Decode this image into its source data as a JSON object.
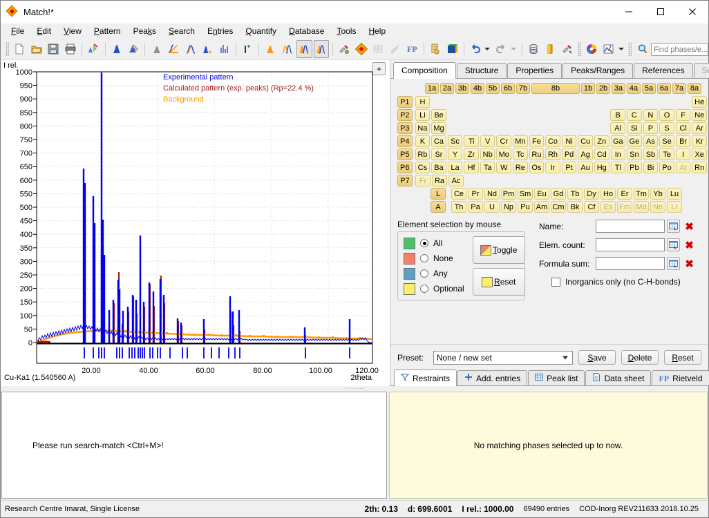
{
  "window": {
    "title": "Match!*",
    "app_icon": "diamond-icon",
    "minimize": "—",
    "maximize": "□",
    "close": "✕"
  },
  "menu": [
    {
      "label": "File",
      "accel": "F"
    },
    {
      "label": "Edit",
      "accel": "E"
    },
    {
      "label": "View",
      "accel": "V"
    },
    {
      "label": "Pattern",
      "accel": "P"
    },
    {
      "label": "Peaks",
      "accel": "k"
    },
    {
      "label": "Search",
      "accel": "S"
    },
    {
      "label": "Entries",
      "accel": "n"
    },
    {
      "label": "Quantify",
      "accel": "Q"
    },
    {
      "label": "Database",
      "accel": "D"
    },
    {
      "label": "Tools",
      "accel": "T"
    },
    {
      "label": "Help",
      "accel": "H"
    }
  ],
  "toolbar": {
    "icons": [
      "new-document-icon",
      "open-folder-icon",
      "save-disk-icon",
      "print-icon",
      "import-pattern-icon",
      "peak-single-icon",
      "pattern-tools-icon",
      "raw-profile-icon",
      "background-icon",
      "smooth-icon",
      "strip-ka2-icon",
      "peak-bars-icon",
      "add-peak-icon",
      "single-peak-fit-icon",
      "profile-fit-icon",
      "fit-profile-a-icon",
      "fit-profile-b-icon",
      "search-match-tools-icon",
      "diamond-entry-icon",
      "disabled-grid-icon",
      "disabled-pencil-icon",
      "fp-label",
      "report-icon",
      "3d-cube-icon",
      "undo-icon",
      "redo-icon",
      "database-icon",
      "gold-bar-icon",
      "settings-tools-icon",
      "color-wheel-icon",
      "chart-options-icon",
      "search-icon"
    ],
    "fp_label": "FP",
    "search_placeholder": "Find phases/e..."
  },
  "chart_data": {
    "type": "line",
    "title": "",
    "xlabel": "2theta",
    "ylabel": "I rel.",
    "source_label": "Cu-Ka1 (1.540560 A)",
    "xlim": [
      3,
      120
    ],
    "ylim": [
      0,
      1000
    ],
    "xticks": [
      "20.00",
      "40.00",
      "60.00",
      "80.00",
      "100.00",
      "120.00"
    ],
    "xtick_values": [
      20,
      40,
      60,
      80,
      100,
      120
    ],
    "yticks": [
      "0",
      "50",
      "100",
      "150",
      "200",
      "250",
      "300",
      "350",
      "400",
      "450",
      "500",
      "550",
      "600",
      "650",
      "700",
      "750",
      "800",
      "850",
      "900",
      "950",
      "1000"
    ],
    "ytick_values": [
      0,
      50,
      100,
      150,
      200,
      250,
      300,
      350,
      400,
      450,
      500,
      550,
      600,
      650,
      700,
      750,
      800,
      850,
      900,
      950,
      1000
    ],
    "grid": true,
    "legend": [
      {
        "label": "Experimental pattern",
        "color": "#0000ee"
      },
      {
        "label": "Calculated pattern (exp. peaks) (Rp=22.4 %)",
        "color": "#a02020"
      },
      {
        "label": "Background",
        "color": "#ff9900"
      }
    ],
    "series": [
      {
        "name": "Experimental pattern",
        "color": "#0000ee",
        "peaks": [
          {
            "x": 17.8,
            "y": 645
          },
          {
            "x": 17.5,
            "y": 592
          },
          {
            "x": 20.9,
            "y": 540
          },
          {
            "x": 21.2,
            "y": 445
          },
          {
            "x": 23.6,
            "y": 1000
          },
          {
            "x": 24.1,
            "y": 455
          },
          {
            "x": 24.4,
            "y": 325
          },
          {
            "x": 26.5,
            "y": 120
          },
          {
            "x": 28.0,
            "y": 160
          },
          {
            "x": 29.5,
            "y": 235
          },
          {
            "x": 30.1,
            "y": 200
          },
          {
            "x": 31.4,
            "y": 118
          },
          {
            "x": 33.2,
            "y": 135
          },
          {
            "x": 34.4,
            "y": 175
          },
          {
            "x": 35.5,
            "y": 160
          },
          {
            "x": 36.1,
            "y": 402
          },
          {
            "x": 36.8,
            "y": 150
          },
          {
            "x": 38.6,
            "y": 225
          },
          {
            "x": 39.2,
            "y": 190
          },
          {
            "x": 41.5,
            "y": 235
          },
          {
            "x": 42.0,
            "y": 180
          },
          {
            "x": 47.2,
            "y": 90
          },
          {
            "x": 47.6,
            "y": 75
          },
          {
            "x": 55.5,
            "y": 88
          },
          {
            "x": 64.8,
            "y": 175
          },
          {
            "x": 65.4,
            "y": 120
          },
          {
            "x": 67.3,
            "y": 110
          },
          {
            "x": 90.2,
            "y": 55
          },
          {
            "x": 105.8,
            "y": 88
          }
        ]
      },
      {
        "name": "Calculated pattern (exp. peaks)",
        "color": "#a02020",
        "rp": "22.4 %"
      },
      {
        "name": "Background",
        "color": "#ff9900"
      }
    ],
    "tick_marks_2theta": [
      17.8,
      20.8,
      22.6,
      23.1,
      23.6,
      28.4,
      29.0,
      29.6,
      31.9,
      32.4,
      33.0,
      34.1,
      34.5,
      34.9,
      35.3,
      36.1,
      37.0,
      37.5,
      38.6,
      39.2,
      42.5,
      47.5,
      55.2,
      56.3,
      62.0,
      64.1,
      66.0,
      67.3,
      90.1,
      105.7
    ]
  },
  "tabs": {
    "items": [
      {
        "label": "Composition",
        "active": true,
        "disabled": false
      },
      {
        "label": "Structure",
        "active": false,
        "disabled": false
      },
      {
        "label": "Properties",
        "active": false,
        "disabled": false
      },
      {
        "label": "Peaks/Ranges",
        "active": false,
        "disabled": false
      },
      {
        "label": "References",
        "active": false,
        "disabled": false
      },
      {
        "label": "Subfiles",
        "active": false,
        "disabled": true
      }
    ],
    "add_tab_button": "+"
  },
  "periodic_table": {
    "groups": [
      "1a",
      "2a",
      "3b",
      "4b",
      "5b",
      "6b",
      "7b",
      "8b",
      "1b",
      "2b",
      "3a",
      "4a",
      "5a",
      "6a",
      "7a",
      "8a"
    ],
    "periods": [
      "P1",
      "P2",
      "P3",
      "P4",
      "P5",
      "P6",
      "P7"
    ],
    "rows": [
      {
        "period": "P1",
        "cells": [
          {
            "s": "H"
          },
          {
            "gap": 16
          },
          {
            "s": "He"
          }
        ]
      },
      {
        "period": "P2",
        "cells": [
          {
            "s": "Li"
          },
          {
            "s": "Be"
          },
          {
            "gap": 10
          },
          {
            "s": "B"
          },
          {
            "s": "C"
          },
          {
            "s": "N"
          },
          {
            "s": "O"
          },
          {
            "s": "F"
          },
          {
            "s": "Ne"
          }
        ]
      },
      {
        "period": "P3",
        "cells": [
          {
            "s": "Na"
          },
          {
            "s": "Mg"
          },
          {
            "gap": 10
          },
          {
            "s": "Al"
          },
          {
            "s": "Si"
          },
          {
            "s": "P"
          },
          {
            "s": "S"
          },
          {
            "s": "Cl"
          },
          {
            "s": "Ar"
          }
        ]
      },
      {
        "period": "P4",
        "cells": [
          {
            "s": "K"
          },
          {
            "s": "Ca"
          },
          {
            "s": "Sc"
          },
          {
            "s": "Ti"
          },
          {
            "s": "V"
          },
          {
            "s": "Cr"
          },
          {
            "s": "Mn"
          },
          {
            "s": "Fe"
          },
          {
            "s": "Co"
          },
          {
            "s": "Ni"
          },
          {
            "s": "Cu"
          },
          {
            "s": "Zn"
          },
          {
            "s": "Ga"
          },
          {
            "s": "Ge"
          },
          {
            "s": "As"
          },
          {
            "s": "Se"
          },
          {
            "s": "Br"
          },
          {
            "s": "Kr"
          }
        ]
      },
      {
        "period": "P5",
        "cells": [
          {
            "s": "Rb"
          },
          {
            "s": "Sr"
          },
          {
            "s": "Y"
          },
          {
            "s": "Zr"
          },
          {
            "s": "Nb"
          },
          {
            "s": "Mo"
          },
          {
            "s": "Tc"
          },
          {
            "s": "Ru"
          },
          {
            "s": "Rh"
          },
          {
            "s": "Pd"
          },
          {
            "s": "Ag"
          },
          {
            "s": "Cd"
          },
          {
            "s": "In"
          },
          {
            "s": "Sn"
          },
          {
            "s": "Sb"
          },
          {
            "s": "Te"
          },
          {
            "s": "I"
          },
          {
            "s": "Xe"
          }
        ]
      },
      {
        "period": "P6",
        "cells": [
          {
            "s": "Cs"
          },
          {
            "s": "Ba"
          },
          {
            "s": "La"
          },
          {
            "s": "Hf"
          },
          {
            "s": "Ta"
          },
          {
            "s": "W"
          },
          {
            "s": "Re"
          },
          {
            "s": "Os"
          },
          {
            "s": "Ir"
          },
          {
            "s": "Pt"
          },
          {
            "s": "Au"
          },
          {
            "s": "Hg"
          },
          {
            "s": "Tl"
          },
          {
            "s": "Pb"
          },
          {
            "s": "Bi"
          },
          {
            "s": "Po"
          },
          {
            "s": "At",
            "dim": true
          },
          {
            "s": "Rn"
          }
        ]
      },
      {
        "period": "P7",
        "cells": [
          {
            "s": "Fr",
            "dim": true
          },
          {
            "s": "Ra"
          },
          {
            "s": "Ac"
          }
        ]
      }
    ],
    "lanthanides": {
      "tag": "L",
      "cells": [
        {
          "s": "Ce"
        },
        {
          "s": "Pr"
        },
        {
          "s": "Nd"
        },
        {
          "s": "Pm"
        },
        {
          "s": "Sm"
        },
        {
          "s": "Eu"
        },
        {
          "s": "Gd"
        },
        {
          "s": "Tb"
        },
        {
          "s": "Dy"
        },
        {
          "s": "Ho"
        },
        {
          "s": "Er"
        },
        {
          "s": "Tm"
        },
        {
          "s": "Yb"
        },
        {
          "s": "Lu"
        }
      ]
    },
    "actinides": {
      "tag": "A",
      "cells": [
        {
          "s": "Th"
        },
        {
          "s": "Pa"
        },
        {
          "s": "U"
        },
        {
          "s": "Np"
        },
        {
          "s": "Pu"
        },
        {
          "s": "Am"
        },
        {
          "s": "Cm"
        },
        {
          "s": "Bk"
        },
        {
          "s": "Cf"
        },
        {
          "s": "Es",
          "dim": true
        },
        {
          "s": "Fm",
          "dim": true
        },
        {
          "s": "Md",
          "dim": true
        },
        {
          "s": "No",
          "dim": true
        },
        {
          "s": "Lr",
          "dim": true
        }
      ]
    }
  },
  "selection": {
    "title": "Element selection by mouse",
    "options": [
      {
        "label": "All",
        "color": "#4fc06a",
        "checked": true
      },
      {
        "label": "None",
        "color": "#f5806a",
        "checked": false
      },
      {
        "label": "Any",
        "color": "#5f9fc4",
        "checked": false
      },
      {
        "label": "Optional",
        "color": "#f8f06a",
        "checked": false
      }
    ],
    "toggle_button": "Toggle",
    "reset_button": "Reset"
  },
  "fields": {
    "name": {
      "label": "Name:",
      "value": ""
    },
    "elem_count": {
      "label": "Elem. count:",
      "value": ""
    },
    "formula_sum": {
      "label": "Formula sum:",
      "value": ""
    },
    "inorganics_only": {
      "label": "Inorganics only (no C-H-bonds)",
      "checked": false
    }
  },
  "preset": {
    "label": "Preset:",
    "value": "None / new set",
    "save": "Save",
    "delete": "Delete",
    "reset": "Reset"
  },
  "sub_tabs": [
    {
      "label": "Restraints",
      "icon": "funnel-icon",
      "active": true
    },
    {
      "label": "Add. entries",
      "icon": "plus-icon",
      "active": false
    },
    {
      "label": "Peak list",
      "icon": "table-icon",
      "active": false
    },
    {
      "label": "Data sheet",
      "icon": "document-icon",
      "active": false
    },
    {
      "label": "Rietveld",
      "icon": "fp-icon",
      "active": false
    }
  ],
  "panels": {
    "left_bottom_message": "Please run search-match <Ctrl+M>!",
    "right_bottom_message": "No matching phases selected up to now."
  },
  "statusbar": {
    "license": "Research Centre Imarat, Single License",
    "two_theta_label": "2th:",
    "two_theta_value": "0.13",
    "d_label": "d:",
    "d_value": "699.6001",
    "irel_label": "I rel.:",
    "irel_value": "1000.00",
    "entries": "69490 entries",
    "database": "COD-Inorg REV211633 2018.10.25"
  }
}
